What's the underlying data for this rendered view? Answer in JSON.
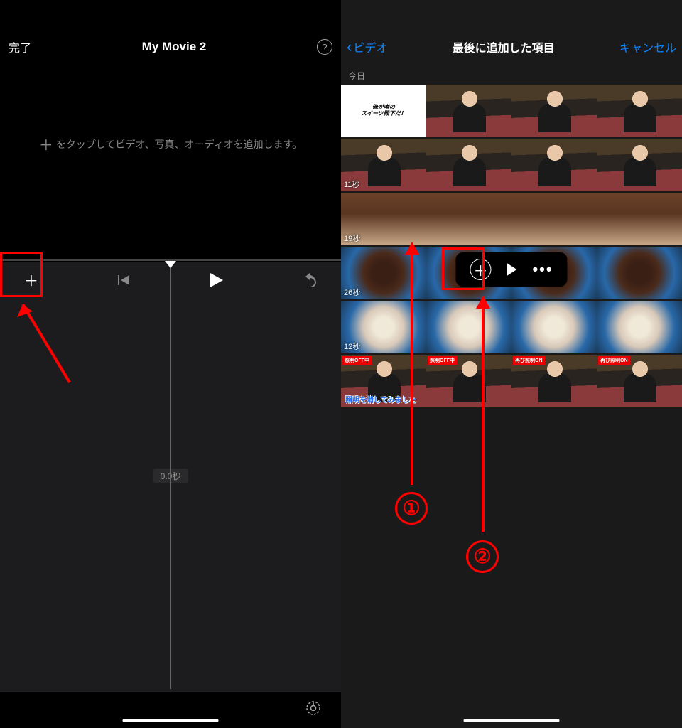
{
  "left": {
    "done_label": "完了",
    "title": "My Movie 2",
    "help": "?",
    "hint_text": "をタップしてビデオ、写真、オーディオを追加します。",
    "hint_plus": "＋",
    "timeline_label": "0.0秒",
    "controls": {
      "add": "＋",
      "rewind": "⏮",
      "play": "▶",
      "undo": "↺"
    },
    "gear": "⚙"
  },
  "right": {
    "back_label": "ビデオ",
    "title": "最後に追加した項目",
    "cancel": "キャンセル",
    "section": "今日",
    "rows": [
      {
        "duration": "",
        "promo": true,
        "promo_lines": [
          "俺が噂の",
          "スイーツ殿下だ！"
        ]
      },
      {
        "duration": "11秒"
      },
      {
        "duration": "19秒",
        "selected": true
      },
      {
        "duration": "26秒"
      },
      {
        "duration": "12秒"
      },
      {
        "duration": "",
        "badges": [
          "照明OFF中",
          "照明OFF中",
          "再び照明ON",
          "再び照明ON"
        ],
        "caption": "照明を消してみました"
      }
    ],
    "action_bar": {
      "add": "＋",
      "play": "▶",
      "more": "•••"
    }
  },
  "annotations": {
    "num1": "①",
    "num2": "②"
  }
}
